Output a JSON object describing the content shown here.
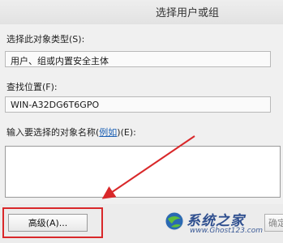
{
  "window": {
    "title": "选择用户或组"
  },
  "object_type": {
    "label": "选择此对象类型(S):",
    "value": "用户、组或内置安全主体"
  },
  "location": {
    "label": "查找位置(F):",
    "value": "WIN-A32DG6T6GPO"
  },
  "object_names": {
    "label_before": "输入要选择的对象名称(",
    "link": "例如",
    "label_after": ")(E):"
  },
  "buttons": {
    "advanced": "高级(A)...",
    "ok": "确定"
  },
  "watermark": {
    "brand": "系统之家",
    "url": "www.Ghost123.com"
  },
  "colors": {
    "highlight": "#d9282a",
    "link": "#1a5fb4",
    "watermark": "#2f4f8f"
  }
}
